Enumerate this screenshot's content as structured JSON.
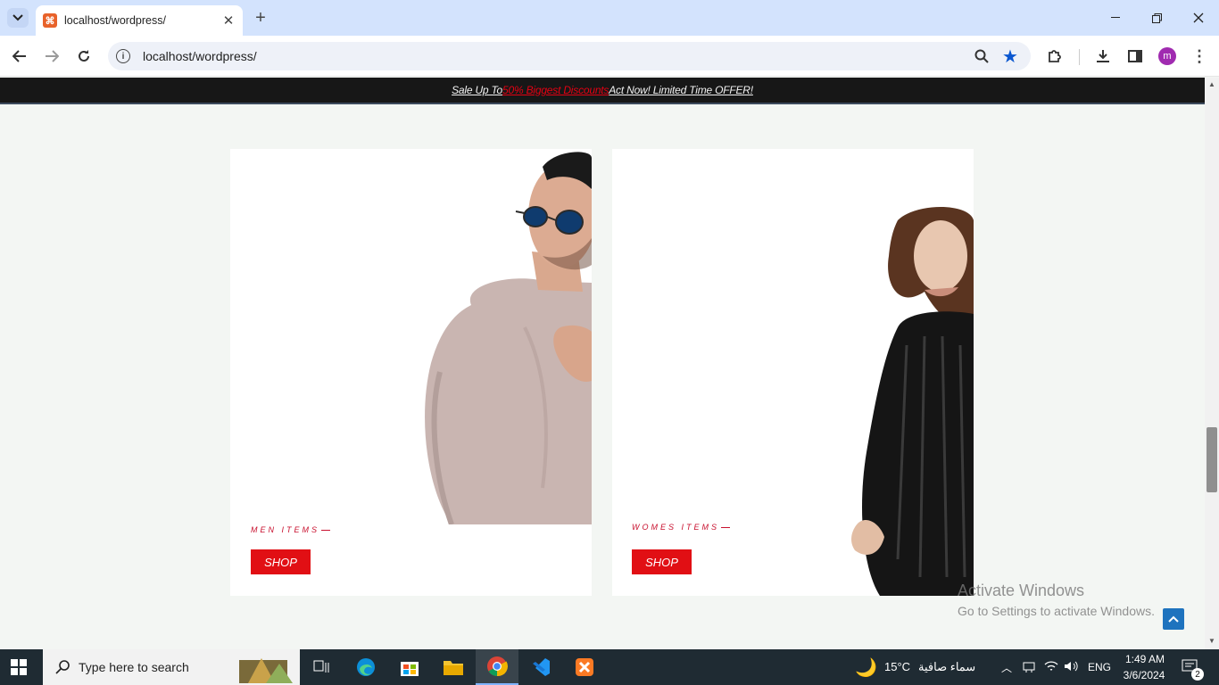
{
  "browser": {
    "tab_title": "localhost/wordpress/",
    "tab_favicon_glyph": "⌘",
    "url": "localhost/wordpress/",
    "profile_initial": "m"
  },
  "promo": {
    "prefix": "Sale Up To ",
    "highlight": "50% Biggest Discounts",
    "suffix": " Act Now! Limited Time OFFER!",
    "highlight_color": "#e60012"
  },
  "cards": {
    "men": {
      "label": "MEN ITEMS",
      "button": "SHOP"
    },
    "women": {
      "label": "WOMES ITEMS",
      "button": "SHOP"
    }
  },
  "activate": {
    "title": "Activate Windows",
    "subtitle": "Go to Settings to activate Windows."
  },
  "taskbar": {
    "search_placeholder": "Type here to search",
    "weather_temp": "15°C",
    "weather_desc": "سماء صافية",
    "language": "ENG",
    "time": "1:49 AM",
    "date": "3/6/2024",
    "notification_count": "2"
  },
  "colors": {
    "accent_red": "#e10f14",
    "chrome_blue": "#d3e3fd"
  }
}
